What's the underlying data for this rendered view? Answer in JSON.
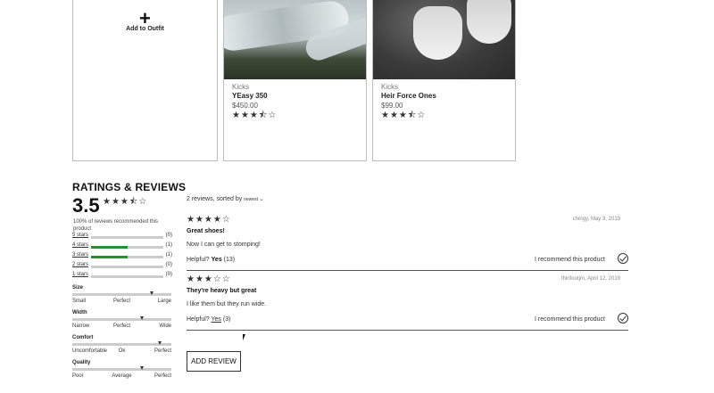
{
  "outfit": {
    "add_icon": "+",
    "add_label": "Add to Outfit"
  },
  "products": [
    {
      "category": "Kicks",
      "name": "YEasy 350",
      "price": "$450.00",
      "stars": "★★★⯪☆"
    },
    {
      "category": "Kicks",
      "name": "Heir Force Ones",
      "price": "$99.00",
      "stars": "★★★⯪☆"
    }
  ],
  "ratings": {
    "title": "RATINGS & REVIEWS",
    "average": "3.5",
    "average_stars": "★★★⯪☆",
    "recommend_text": "100% of reviews recommended this product",
    "breakdown": [
      {
        "label": "5 stars",
        "count": "(0)",
        "fraction": 0
      },
      {
        "label": "4 stars",
        "count": "(1)",
        "fraction": 0.5
      },
      {
        "label": "3 stars",
        "count": "(1)",
        "fraction": 0.5
      },
      {
        "label": "2 stars",
        "count": "(0)",
        "fraction": 0
      },
      {
        "label": "1 stars",
        "count": "(0)",
        "fraction": 0
      }
    ],
    "factors": [
      {
        "name": "Size",
        "low": "Small",
        "mid": "Perfect",
        "high": "Large",
        "level": 0.8
      },
      {
        "name": "Width",
        "low": "Narrow",
        "mid": "Perfect",
        "high": "Wide",
        "level": 0.7
      },
      {
        "name": "Comfort",
        "low": "Uncomfortable",
        "mid": "Ok",
        "high": "Perfect",
        "level": 0.88
      },
      {
        "name": "Quality",
        "low": "Poor",
        "mid": "Average",
        "high": "Perfect",
        "level": 0.7
      }
    ]
  },
  "reviews": {
    "sort_prefix": "2 reviews, sorted by",
    "sort_value": "newest",
    "items": [
      {
        "stars": "★★★★☆",
        "meta": "chingy, May 3, 2019",
        "title": "Great shoes!",
        "body": "Now I can get to stomping!",
        "helpful_label": "Helpful?",
        "yes_label": "Yes",
        "yes_count": "(13)",
        "recommend": "I recommend this product"
      },
      {
        "stars": "★★★☆☆",
        "meta": "thinfootjm, April 12, 2019",
        "title": "They're heavy but great",
        "body": "I like them but they run wide.",
        "helpful_label": "Helpful?",
        "yes_label": "Yes",
        "yes_count": "(3)",
        "recommend": "I recommend this product"
      }
    ],
    "add_review_label": "ADD REVIEW"
  },
  "icons": {
    "add": "plus-icon",
    "check": "check-circle-icon",
    "sort": "chevron-down-icon",
    "cursor": "mouse-pointer-icon"
  }
}
